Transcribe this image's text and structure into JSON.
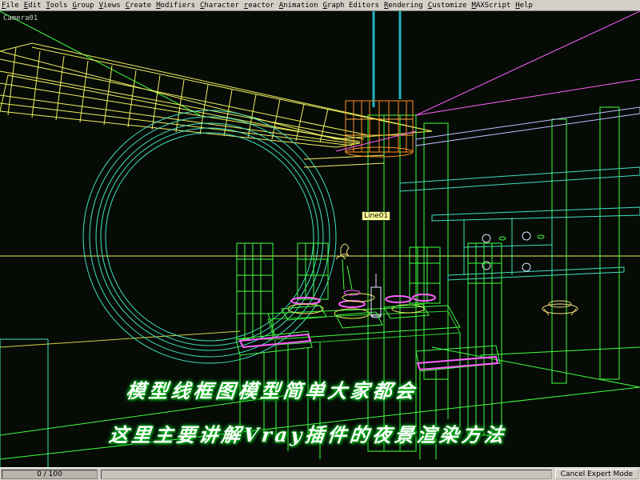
{
  "menubar": {
    "items": [
      "File",
      "Edit",
      "Tools",
      "Group",
      "Views",
      "Create",
      "Modifiers",
      "Character",
      "reactor",
      "Animation",
      "Graph Editors",
      "Rendering",
      "Customize",
      "MAXScript",
      "Help"
    ]
  },
  "viewport": {
    "label": "Camera01",
    "tooltip": "Line01"
  },
  "overlay": {
    "line1": "模型线框图模型简单大家都会",
    "line2": "这里主要讲解Vray插件的夜景渲染方法"
  },
  "statusbar": {
    "time_slider": "0 / 100",
    "cancel_expert": "Cancel Expert Mode"
  },
  "colors": {
    "wire_yellow": "#f0f060",
    "wire_green": "#40ff40",
    "wire_cyan": "#40e0c0",
    "wire_magenta": "#ff60ff",
    "wire_orange": "#ff9020",
    "viewport_bg": "#060b06",
    "menu_bg": "#d4d0c8"
  }
}
